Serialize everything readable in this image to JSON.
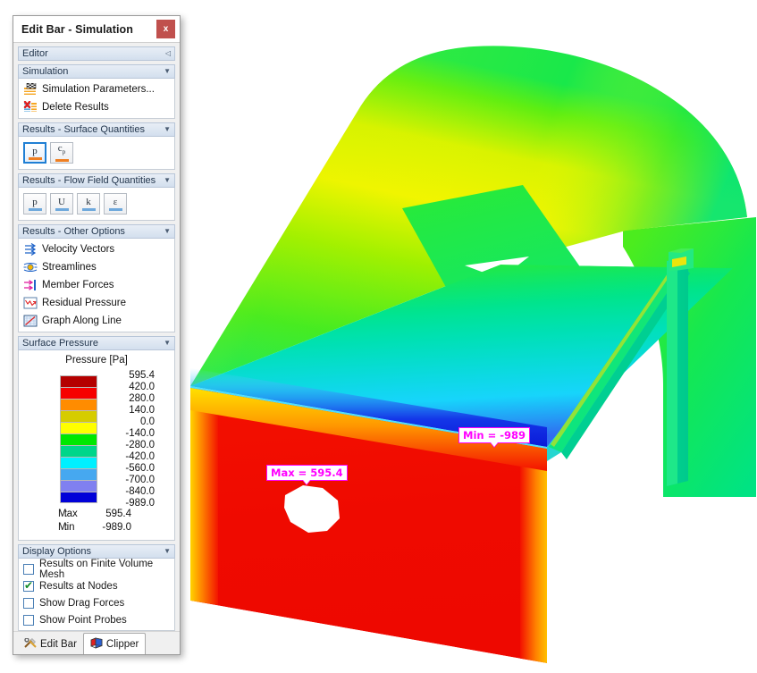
{
  "window": {
    "title": "Edit Bar - Simulation",
    "close_label": "x"
  },
  "groups": {
    "editor": {
      "title": "Editor",
      "arrow": "collapse-left"
    },
    "simulation": {
      "title": "Simulation",
      "items": [
        {
          "label": "Simulation Parameters...",
          "icon": "simulation-parameters-icon"
        },
        {
          "label": "Delete Results",
          "icon": "delete-results-icon"
        }
      ]
    },
    "surface_quantities": {
      "title": "Results - Surface Quantities",
      "buttons": [
        {
          "label": "p",
          "sub": "",
          "selected": true,
          "bar": "orange"
        },
        {
          "label": "c",
          "sub": "p",
          "selected": false,
          "bar": "orange"
        }
      ]
    },
    "flow_field_quantities": {
      "title": "Results - Flow Field Quantities",
      "buttons": [
        {
          "label": "p",
          "sub": "",
          "selected": false,
          "bar": "blue"
        },
        {
          "label": "U",
          "sub": "",
          "selected": false,
          "bar": "blue"
        },
        {
          "label": "k",
          "sub": "",
          "selected": false,
          "bar": "blue"
        },
        {
          "label": "ε",
          "sub": "",
          "selected": false,
          "bar": "blue"
        }
      ]
    },
    "other_options": {
      "title": "Results - Other Options",
      "items": [
        {
          "label": "Velocity Vectors",
          "icon": "velocity-vectors-icon"
        },
        {
          "label": "Streamlines",
          "icon": "streamlines-icon"
        },
        {
          "label": "Member Forces",
          "icon": "member-forces-icon"
        },
        {
          "label": "Residual Pressure",
          "icon": "residual-pressure-icon"
        },
        {
          "label": "Graph Along Line",
          "icon": "graph-along-line-icon"
        }
      ]
    },
    "surface_pressure": {
      "title": "Surface Pressure",
      "legend_title": "Pressure [Pa]",
      "max_key": "Max",
      "min_key": "Min",
      "colon": ":",
      "max_value": "595.4",
      "min_value": "-989.0"
    },
    "display_options": {
      "title": "Display Options",
      "items": [
        {
          "label": "Results on Finite Volume Mesh",
          "checked": false
        },
        {
          "label": "Results at Nodes",
          "checked": true
        },
        {
          "label": "Show Drag Forces",
          "checked": false
        },
        {
          "label": "Show Point Probes",
          "checked": false
        }
      ]
    }
  },
  "tabs": [
    {
      "label": "Edit Bar",
      "icon": "tools-icon",
      "active": false
    },
    {
      "label": "Clipper",
      "icon": "clipper-cube-icon",
      "active": true
    }
  ],
  "viewport": {
    "max_annotation": "Max = 595.4",
    "min_annotation": "Min = -989"
  },
  "chart_data": {
    "type": "heatmap",
    "title": "Surface Pressure",
    "legend_title": "Pressure [Pa]",
    "unit": "Pa",
    "colorbar": {
      "ticks": [
        "595.4",
        "420.0",
        "280.0",
        "140.0",
        "0.0",
        "-140.0",
        "-280.0",
        "-420.0",
        "-560.0",
        "-700.0",
        "-840.0",
        "-989.0"
      ],
      "tick_values": [
        595.4,
        420.0,
        280.0,
        140.0,
        0.0,
        -140.0,
        -280.0,
        -420.0,
        -560.0,
        -700.0,
        -840.0,
        -989.0
      ],
      "colors": [
        "#b40000",
        "#f60000",
        "#ff8c00",
        "#d6cc00",
        "#ffff00",
        "#00e800",
        "#00d68a",
        "#00f0ff",
        "#46a8f0",
        "#8080f0",
        "#0000d8"
      ],
      "band_ranges": [
        [
          420.0,
          595.4
        ],
        [
          280.0,
          420.0
        ],
        [
          140.0,
          280.0
        ],
        [
          0.0,
          140.0
        ],
        [
          -140.0,
          0.0
        ],
        [
          -280.0,
          -140.0
        ],
        [
          -420.0,
          -280.0
        ],
        [
          -560.0,
          -420.0
        ],
        [
          -700.0,
          -560.0
        ],
        [
          -840.0,
          -700.0
        ],
        [
          -989.0,
          -840.0
        ]
      ]
    },
    "max": 595.4,
    "min": -989.0,
    "annotations": [
      {
        "text": "Max = 595.4",
        "value": 595.4
      },
      {
        "text": "Min = -989",
        "value": -989.0
      }
    ]
  }
}
